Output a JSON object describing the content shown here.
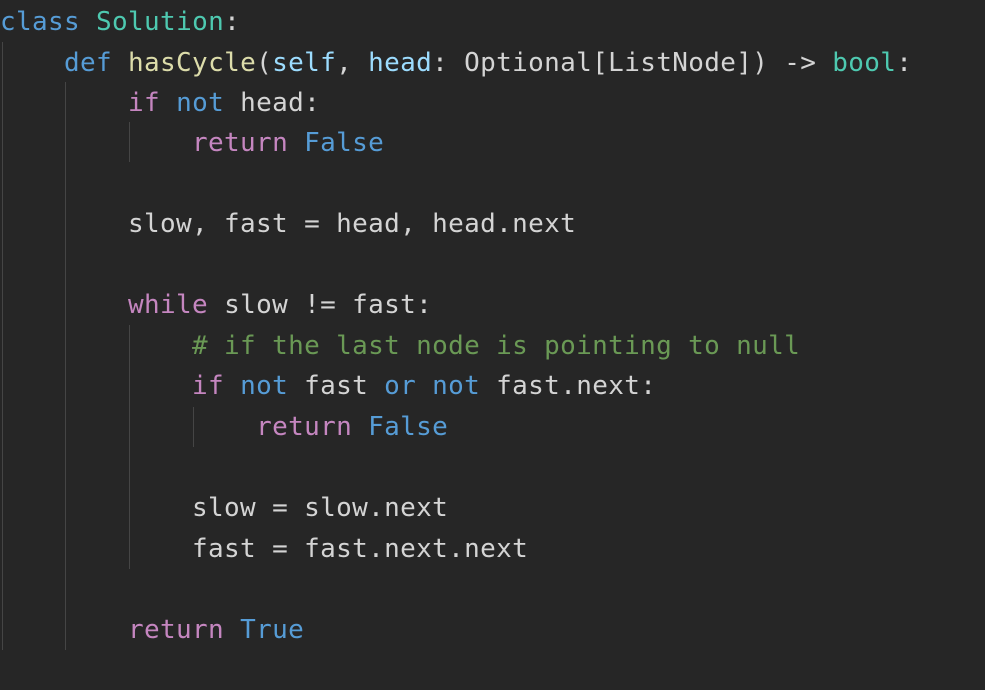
{
  "editor": {
    "language": "python",
    "colors": {
      "background": "#262626",
      "keyword_control": "#c586c0",
      "keyword_storage": "#569cd6",
      "class_name": "#4ec9b0",
      "function_name": "#dcdcaa",
      "parameter": "#9cdcfe",
      "plain": "#d4d4d4",
      "comment": "#6a9955"
    },
    "code": {
      "l1": {
        "kw": "class",
        "sp": " ",
        "name": "Solution",
        "colon": ":"
      },
      "l2": {
        "indent": "    ",
        "kw": "def",
        "sp": " ",
        "fname": "hasCycle",
        "paren_open": "(",
        "self": "self",
        "comma": ", ",
        "param": "head",
        "colon_type": ": ",
        "type": "Optional[ListNode]",
        "paren_close": ")",
        "arrow": " -> ",
        "ret_type": "bool",
        "colon": ":"
      },
      "l3": {
        "indent": "        ",
        "kw_if": "if",
        "sp": " ",
        "kw_not": "not",
        "rest": " head:"
      },
      "l4": {
        "indent": "            ",
        "kw": "return",
        "sp": " ",
        "val": "False"
      },
      "l6": {
        "indent": "        ",
        "text": "slow, fast = head, head.next"
      },
      "l8": {
        "indent": "        ",
        "kw": "while",
        "rest": " slow != fast:"
      },
      "l9": {
        "indent": "            ",
        "comment": "# if the last node is pointing to null"
      },
      "l10": {
        "indent": "            ",
        "kw_if": "if",
        "sp1": " ",
        "kw_not1": "not",
        "mid1": " fast ",
        "kw_or": "or",
        "sp2": " ",
        "kw_not2": "not",
        "rest": " fast.next:"
      },
      "l11": {
        "indent": "                ",
        "kw": "return",
        "sp": " ",
        "val": "False"
      },
      "l13": {
        "indent": "            ",
        "text": "slow = slow.next"
      },
      "l14": {
        "indent": "            ",
        "text": "fast = fast.next.next"
      },
      "l16": {
        "indent": "        ",
        "kw": "return",
        "sp": " ",
        "val": "True"
      }
    }
  }
}
